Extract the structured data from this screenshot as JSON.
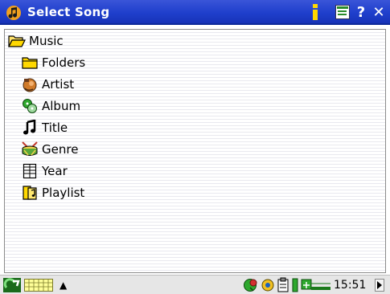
{
  "window": {
    "title": "Select Song",
    "buttons": {
      "info": "i",
      "menu": "menu",
      "help": "?",
      "close": "✕"
    }
  },
  "tree": {
    "root": {
      "label": "Music",
      "icon": "open-folder-icon"
    },
    "items": [
      {
        "label": "Folders",
        "icon": "folder-icon"
      },
      {
        "label": "Artist",
        "icon": "artist-icon"
      },
      {
        "label": "Album",
        "icon": "album-icon"
      },
      {
        "label": "Title",
        "icon": "music-note-icon"
      },
      {
        "label": "Genre",
        "icon": "drum-icon"
      },
      {
        "label": "Year",
        "icon": "calendar-icon"
      },
      {
        "label": "Playlist",
        "icon": "playlist-icon"
      }
    ]
  },
  "statusbar": {
    "clock": "15:51",
    "up_arrow": "▲",
    "right_arrow": "▶"
  },
  "colors": {
    "titlebar": "#1f3fcc",
    "folder": "#ffd800",
    "accent_green": "#1aa01a"
  }
}
